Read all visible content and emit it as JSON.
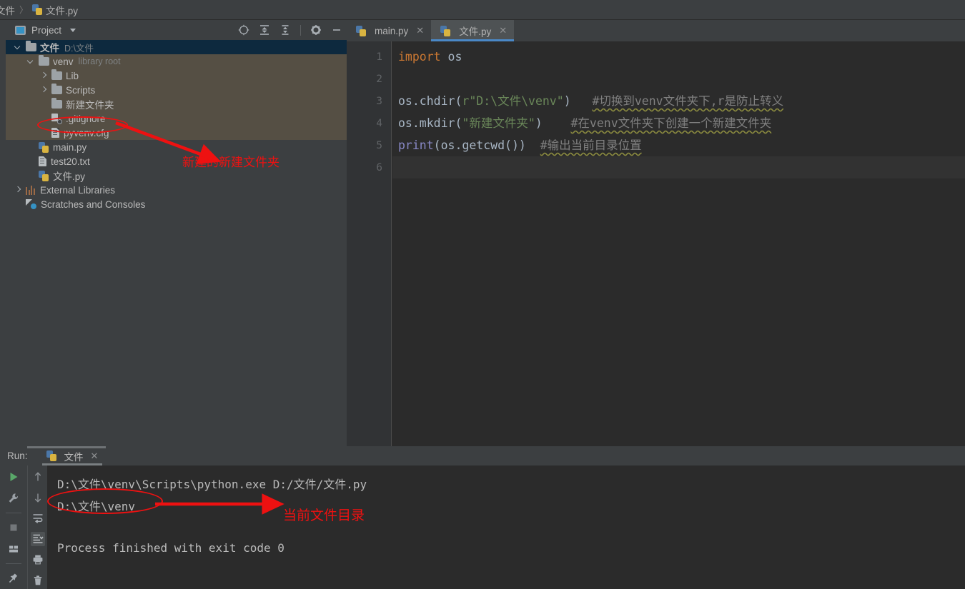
{
  "breadcrumb": {
    "items": [
      {
        "label": "文件",
        "icon": "none"
      },
      {
        "label": "文件.py",
        "icon": "python-file-icon"
      }
    ],
    "separator": "〉"
  },
  "project_panel": {
    "title": "Project",
    "caret": "chevron-down-icon",
    "toolbar_icons": [
      {
        "name": "select-opened-file-icon",
        "tooltip": "Select Opened File"
      },
      {
        "name": "expand-all-icon",
        "tooltip": "Expand All"
      },
      {
        "name": "collapse-all-icon",
        "tooltip": "Collapse All"
      },
      {
        "name": "gear-icon",
        "tooltip": "Settings"
      },
      {
        "name": "minimize-icon",
        "tooltip": "Hide"
      }
    ],
    "tree": [
      {
        "indent": 0,
        "arrow": "down",
        "icon": "folder-icon",
        "label": "文件",
        "sub": "D:\\文件",
        "selected": true,
        "bold": true
      },
      {
        "indent": 1,
        "arrow": "down",
        "icon": "folder-icon",
        "label": "venv",
        "sub": "library root",
        "selected": false,
        "bold": false
      },
      {
        "indent": 2,
        "arrow": "right",
        "icon": "folder-icon",
        "label": "Lib",
        "sub": "",
        "selected": false,
        "bold": false
      },
      {
        "indent": 2,
        "arrow": "right",
        "icon": "folder-icon",
        "label": "Scripts",
        "sub": "",
        "selected": false,
        "bold": false
      },
      {
        "indent": 2,
        "arrow": "none",
        "icon": "folder-icon",
        "label": "新建文件夹",
        "sub": "",
        "selected": false,
        "bold": false
      },
      {
        "indent": 2,
        "arrow": "none",
        "icon": "gitignore-file-icon",
        "label": ".gitignore",
        "sub": "",
        "selected": false,
        "bold": false
      },
      {
        "indent": 2,
        "arrow": "none",
        "icon": "text-file-icon",
        "label": "pyvenv.cfg",
        "sub": "",
        "selected": false,
        "bold": false
      },
      {
        "indent": 1,
        "arrow": "none",
        "icon": "python-file-icon",
        "label": "main.py",
        "sub": "",
        "selected": false,
        "bold": false
      },
      {
        "indent": 1,
        "arrow": "none",
        "icon": "text-file-icon",
        "label": "test20.txt",
        "sub": "",
        "selected": false,
        "bold": false
      },
      {
        "indent": 1,
        "arrow": "none",
        "icon": "python-file-icon",
        "label": "文件.py",
        "sub": "",
        "selected": false,
        "bold": false
      },
      {
        "indent": 0,
        "arrow": "right",
        "icon": "libraries-icon",
        "label": "External Libraries",
        "sub": "",
        "selected": false,
        "bold": false
      },
      {
        "indent": 0,
        "arrow": "none",
        "icon": "scratches-icon",
        "label": "Scratches and Consoles",
        "sub": "",
        "selected": false,
        "bold": false
      }
    ]
  },
  "editor": {
    "tabs": [
      {
        "label": "main.py",
        "active": false,
        "close": "✕"
      },
      {
        "label": "文件.py",
        "active": true,
        "close": "✕"
      }
    ],
    "line_numbers": [
      "1",
      "2",
      "3",
      "4",
      "5",
      "6"
    ],
    "current_line": 6,
    "lines": [
      {
        "n": 1,
        "tokens": [
          {
            "t": "import ",
            "c": "kw"
          },
          {
            "t": "os",
            "c": "plain"
          }
        ]
      },
      {
        "n": 2,
        "tokens": []
      },
      {
        "n": 3,
        "tokens": [
          {
            "t": "os.chdir(",
            "c": "plain"
          },
          {
            "t": "r\"D:\\文件\\venv\"",
            "c": "str"
          },
          {
            "t": ")   ",
            "c": "plain"
          },
          {
            "t": "#切换到venv文件夹下,r是防止转义",
            "c": "cmt"
          }
        ]
      },
      {
        "n": 4,
        "tokens": [
          {
            "t": "os.mkdir(",
            "c": "plain"
          },
          {
            "t": "\"新建文件夹\"",
            "c": "str"
          },
          {
            "t": ")    ",
            "c": "plain"
          },
          {
            "t": "#在venv文件夹下创建一个新建文件夹",
            "c": "cmt"
          }
        ]
      },
      {
        "n": 5,
        "tokens": [
          {
            "t": "print",
            "c": "builtin"
          },
          {
            "t": "(os.getcwd())  ",
            "c": "plain"
          },
          {
            "t": "#输出当前目录位置",
            "c": "cmt"
          }
        ]
      },
      {
        "n": 6,
        "tokens": []
      }
    ],
    "plain_text": [
      "import os",
      "",
      "os.chdir(r\"D:\\文件\\venv\")   #切换到venv文件夹下,r是防止转义",
      "os.mkdir(\"新建文件夹\")    #在venv文件夹下创建一个新建文件夹",
      "print(os.getcwd())  #输出当前目录位置",
      ""
    ]
  },
  "run_panel": {
    "label": "Run:",
    "tab": {
      "label": "文件",
      "icon": "python-run-icon",
      "close": "✕"
    },
    "toolbar_left": [
      {
        "name": "run-icon",
        "glyph": "▶"
      },
      {
        "name": "rerun-wrench-icon",
        "glyph": "wrench"
      },
      {
        "name": "stop-icon",
        "glyph": "■"
      },
      {
        "name": "layout-icon",
        "glyph": "layout"
      },
      {
        "name": "pin-icon",
        "glyph": "pin"
      }
    ],
    "toolbar_right": [
      {
        "name": "up-arrow-icon",
        "glyph": "↑"
      },
      {
        "name": "down-arrow-icon",
        "glyph": "↓"
      },
      {
        "name": "soft-wrap-icon",
        "glyph": "wrap"
      },
      {
        "name": "scroll-to-end-icon",
        "glyph": "scroll-end",
        "active": true
      },
      {
        "name": "print-icon",
        "glyph": "printer"
      },
      {
        "name": "clear-all-icon",
        "glyph": "trash"
      }
    ],
    "console_lines": [
      "D:\\文件\\venv\\Scripts\\python.exe D:/文件/文件.py",
      "D:\\文件\\venv",
      "",
      "Process finished with exit code 0"
    ]
  },
  "annotations": [
    {
      "name": "tree-annotation",
      "text": "新建的新建文件夹",
      "color": "#ee1111",
      "target": "新建文件夹"
    },
    {
      "name": "console-annotation",
      "text": "当前文件目录",
      "color": "#ee1111",
      "target": "D:\\文件\\venv"
    }
  ],
  "colors": {
    "panel_bg": "#3c3f41",
    "editor_bg": "#2b2b2b",
    "gutter_bg": "#313335",
    "selection_blue": "#0d293e",
    "excluded_brown": "#554f44",
    "tab_active": "#4e5254",
    "tab_underline": "#4a88c7",
    "keyword_orange": "#cc7832",
    "string_green": "#6a8759",
    "comment_gray": "#808080",
    "builtin_purple": "#8888c6",
    "text_main": "#a9b7c6",
    "annotation_red": "#ee1111"
  }
}
